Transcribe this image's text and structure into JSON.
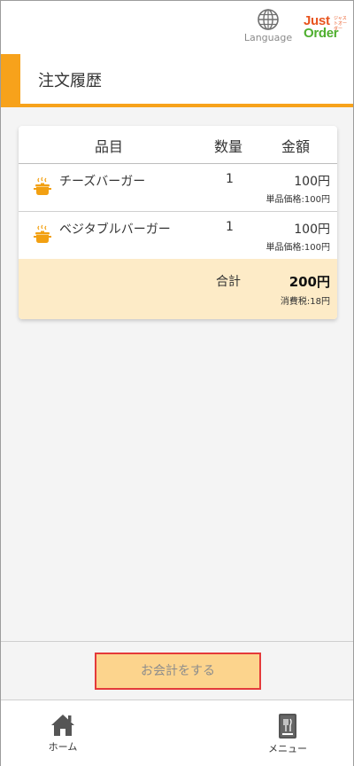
{
  "header": {
    "language_label": "Language",
    "logo_text_top": "Just",
    "logo_text_bottom": "Order",
    "logo_small_text": "ジャストオーダー"
  },
  "page": {
    "title": "注文履歴"
  },
  "table": {
    "headers": [
      "品目",
      "数量",
      "金額"
    ],
    "rows": [
      {
        "name": "チーズバーガー",
        "qty": "1",
        "price": "100円",
        "unit_price": "単品価格:100円"
      },
      {
        "name": "ベジタブルバーガー",
        "qty": "1",
        "price": "100円",
        "unit_price": "単品価格:100円"
      }
    ],
    "total_label": "合計",
    "total_amount": "200円",
    "tax": "消費税:18円"
  },
  "checkout": {
    "label": "お会計をする"
  },
  "nav": {
    "home_label": "ホーム",
    "menu_label": "メニュー"
  },
  "colors": {
    "accent": "#f7a21b",
    "total_bg": "#fdebc7",
    "checkout_bg": "#fcd48d",
    "highlight_border": "#e43a3a",
    "logo_orange": "#e8541e",
    "logo_green": "#4faf2f"
  },
  "icons": {
    "language": "globe-icon",
    "item": "pot-icon",
    "home": "home-icon",
    "menu": "menu-book-icon"
  }
}
